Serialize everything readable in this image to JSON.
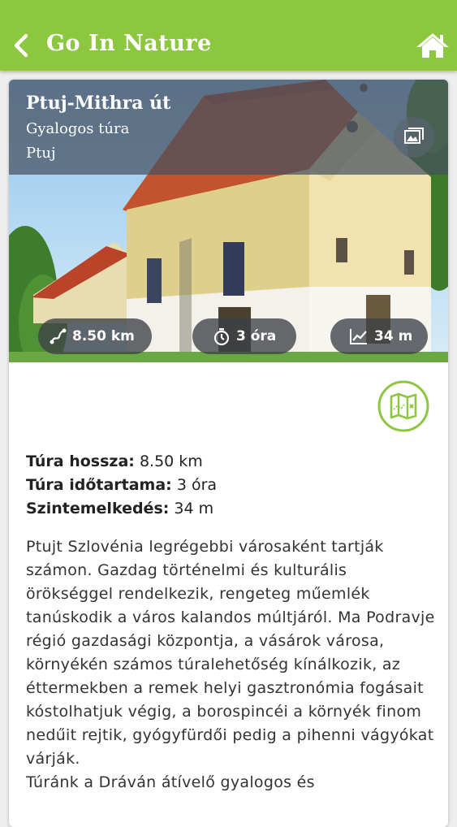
{
  "header": {
    "title": "Go In Nature",
    "back_icon": "chevron-left-icon",
    "home_icon": "home-icon",
    "accent": "#8dc63f"
  },
  "tour": {
    "name": "Ptuj-Mithra út",
    "type": "Gyalogos túra",
    "city": "Ptuj",
    "stats": {
      "distance": "8.50 km",
      "duration": "3 óra",
      "elevation": "34 m"
    }
  },
  "details": {
    "length_label": "Túra hossza:",
    "length_value": "8.50 km",
    "duration_label": "Túra időtartama:",
    "duration_value": "3 óra",
    "elevation_label": "Szintemelkedés:",
    "elevation_value": "34 m"
  },
  "description": {
    "paragraph1": "Ptujt Szlovénia legrégebbi városaként tartják számon. Gazdag történelmi és kulturális örökséggel rendelkezik, rengeteg műemlék tanúskodik a város kalandos múltjáról. Ma Podravje régió gazdasági központja, a vásárok városa, környékén számos túralehetőség kínálkozik, az éttermekben a remek helyi gasztronómia fogásait kóstolhatjuk végig, a borospincéi a környék finom nedűit rejtik, gyógyfürdői pedig a pihenni vágyókat várják.",
    "paragraph2": "Túránk a Dráván átívelő gyalogos és"
  }
}
